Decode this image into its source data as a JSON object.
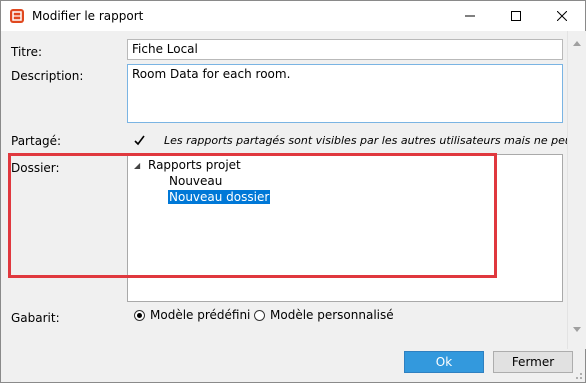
{
  "window": {
    "title": "Modifier le rapport",
    "accent_color": "#0078d7",
    "highlight_color": "#e0383e",
    "icon": "report-icon"
  },
  "form": {
    "title_label": "Titre:",
    "title_value": "Fiche Local",
    "description_label": "Description:",
    "description_value": "Room Data for each room.",
    "shared_label": "Partagé:",
    "shared_checked": true,
    "shared_note": "Les rapports partagés sont visibles par les autres utilisateurs mais ne peuvent",
    "folder_label": "Dossier:",
    "template_label": "Gabarit:"
  },
  "tree": {
    "root": "Rapports projet",
    "children": [
      {
        "label": "Nouveau",
        "selected": false
      },
      {
        "label": "Nouveau dossier",
        "selected": true
      }
    ]
  },
  "template_options": [
    {
      "label": "Modèle prédéfini",
      "selected": true
    },
    {
      "label": "Modèle personnalisé",
      "selected": false
    }
  ],
  "buttons": {
    "ok": "Ok",
    "close": "Fermer"
  }
}
